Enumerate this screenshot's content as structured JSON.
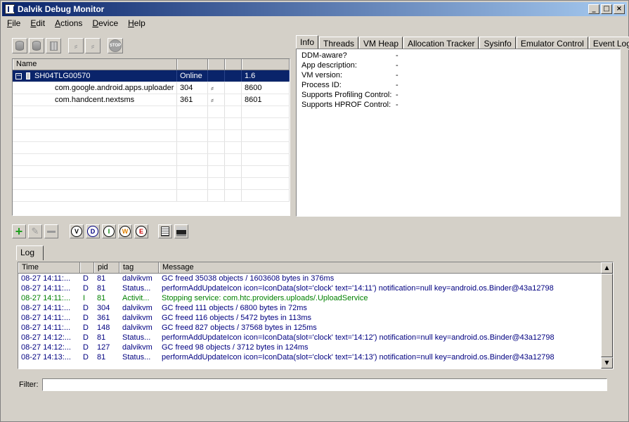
{
  "window": {
    "title": "Dalvik Debug Monitor",
    "minimize": "_",
    "maximize": "□",
    "close": "×"
  },
  "menu": [
    {
      "label": "File",
      "key": "F",
      "rest": "ile"
    },
    {
      "label": "Edit",
      "key": "E",
      "rest": "dit"
    },
    {
      "label": "Actions",
      "key": "A",
      "rest": "ctions"
    },
    {
      "label": "Device",
      "key": "D",
      "rest": "evice"
    },
    {
      "label": "Help",
      "key": "H",
      "rest": "elp"
    }
  ],
  "devices": {
    "headers": [
      "Name",
      "",
      "",
      "",
      ""
    ],
    "device": {
      "name": "SH04TLG00570",
      "status": "Online",
      "version": "1.6",
      "expander": "−"
    },
    "clients": [
      {
        "name": "com.google.android.apps.uploader",
        "pid": "304",
        "port": "8600"
      },
      {
        "name": "com.handcent.nextsms",
        "pid": "361",
        "port": "8601"
      }
    ]
  },
  "tabs": [
    "Info",
    "Threads",
    "VM Heap",
    "Allocation Tracker",
    "Sysinfo",
    "Emulator Control",
    "Event Log"
  ],
  "info": [
    {
      "label": "DDM-aware?",
      "value": "-"
    },
    {
      "label": "App description:",
      "value": "-"
    },
    {
      "label": "VM version:",
      "value": "-"
    },
    {
      "label": "Process ID:",
      "value": "-"
    },
    {
      "label": "Supports Profiling Control:",
      "value": "-"
    },
    {
      "label": "Supports HPROF Control:",
      "value": "-"
    }
  ],
  "log_toolbar": {
    "verbose": "V",
    "debug": "D",
    "info": "I",
    "warn": "W",
    "error": "E"
  },
  "log": {
    "tab": "Log",
    "headers": [
      "Time",
      "",
      "pid",
      "tag",
      "Message"
    ],
    "rows": [
      {
        "time": "08-27 14:11:...",
        "level": "D",
        "pid": "81",
        "tag": "dalvikvm",
        "msg": "GC freed 35038 objects / 1603608 bytes in 376ms"
      },
      {
        "time": "08-27 14:11:...",
        "level": "D",
        "pid": "81",
        "tag": "Status...",
        "msg": "performAddUpdateIcon icon=IconData(slot='clock' text='14:11') notification=null key=android.os.Binder@43a12798"
      },
      {
        "time": "08-27 14:11:...",
        "level": "I",
        "pid": "81",
        "tag": "Activit...",
        "msg": "Stopping service: com.htc.providers.uploads/.UploadService"
      },
      {
        "time": "08-27 14:11:...",
        "level": "D",
        "pid": "304",
        "tag": "dalvikvm",
        "msg": "GC freed 111 objects / 6800 bytes in 72ms"
      },
      {
        "time": "08-27 14:11:...",
        "level": "D",
        "pid": "361",
        "tag": "dalvikvm",
        "msg": "GC freed 116 objects / 5472 bytes in 113ms"
      },
      {
        "time": "08-27 14:11:...",
        "level": "D",
        "pid": "148",
        "tag": "dalvikvm",
        "msg": "GC freed 827 objects / 37568 bytes in 125ms"
      },
      {
        "time": "08-27 14:12:...",
        "level": "D",
        "pid": "81",
        "tag": "Status...",
        "msg": "performAddUpdateIcon icon=IconData(slot='clock' text='14:12') notification=null key=android.os.Binder@43a12798"
      },
      {
        "time": "08-27 14:12:...",
        "level": "D",
        "pid": "127",
        "tag": "dalvikvm",
        "msg": "GC freed 98 objects / 3712 bytes in 124ms"
      },
      {
        "time": "08-27 14:13:...",
        "level": "D",
        "pid": "81",
        "tag": "Status...",
        "msg": "performAddUpdateIcon icon=IconData(slot='clock' text='14:13') notification=null key=android.os.Binder@43a12798"
      }
    ]
  },
  "filter": {
    "label": "Filter:",
    "value": ""
  },
  "colors": {
    "title_start": "#0a246a",
    "title_end": "#a6caf0",
    "selection": "#0a246a",
    "info_log": "#008000",
    "debug_log": "#000080",
    "warn_icon": "#e08000",
    "error_icon": "#d00000",
    "add_icon": "#20a020"
  }
}
